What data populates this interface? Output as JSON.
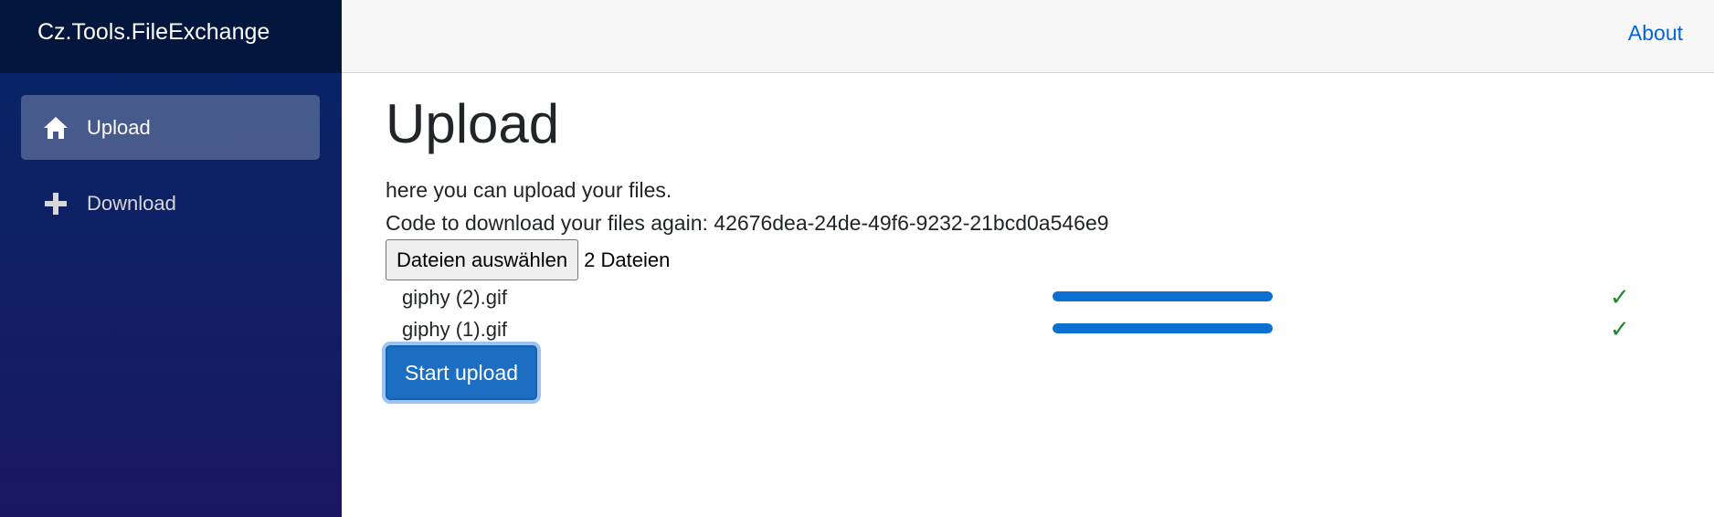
{
  "sidebar": {
    "brand": "Cz.Tools.FileExchange",
    "items": [
      {
        "label": "Upload",
        "icon": "home-icon",
        "active": true
      },
      {
        "label": "Download",
        "icon": "plus-icon",
        "active": false
      }
    ]
  },
  "topbar": {
    "about_label": "About"
  },
  "main": {
    "title": "Upload",
    "intro": "here you can upload your files.",
    "code_line": "Code to download your files again: 42676dea-24de-49f6-9232-21bcd0a546e9",
    "file_picker": {
      "button_label": "Dateien auswählen",
      "count_label": "2 Dateien"
    },
    "files": [
      {
        "name": "giphy (2).gif",
        "progress": 1.0,
        "status": "✓"
      },
      {
        "name": "giphy (1).gif",
        "progress": 1.0,
        "status": "✓"
      }
    ],
    "start_button_label": "Start upload"
  },
  "colors": {
    "accent": "#0c70d2",
    "link": "#0366d6",
    "success": "#1d8a2e",
    "button": "#1b6ec2"
  }
}
